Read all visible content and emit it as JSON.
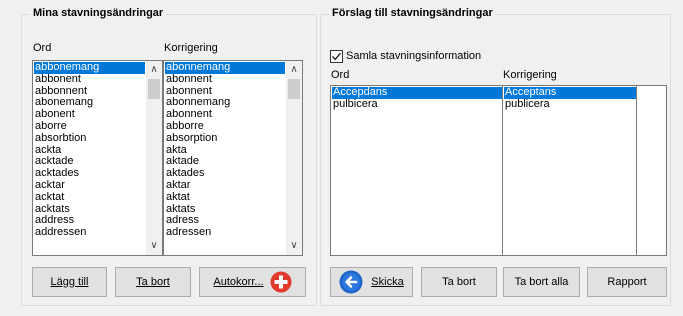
{
  "left_panel": {
    "title": "Mina stavningsändringar",
    "col_ord": "Ord",
    "col_korrigering": "Korrigering",
    "ord_items": [
      "abbonemang",
      "abbonent",
      "abbonnent",
      "abonemang",
      "abonent",
      "aborre",
      "absorbtion",
      "ackta",
      "acktade",
      "acktades",
      "acktar",
      "acktat",
      "acktats",
      "address",
      "addressen"
    ],
    "korr_items": [
      "abonnemang",
      "abonnent",
      "abonnent",
      "abonnemang",
      "abonnent",
      "abborre",
      "absorption",
      "akta",
      "aktade",
      "aktades",
      "aktar",
      "aktat",
      "aktats",
      "adress",
      "adressen"
    ],
    "buttons": {
      "add": "Lägg till",
      "remove": "Ta bort",
      "autocorrect": "Autokorr..."
    }
  },
  "right_panel": {
    "title": "Förslag till stavningsändringar",
    "collect_label": "Samla stavningsinformation",
    "collect_checked": true,
    "col_ord": "Ord",
    "col_korrigering": "Korrigering",
    "ord_items": [
      "Accepdans",
      "pulbicera"
    ],
    "korr_items": [
      "Acceptans",
      "publicera"
    ],
    "buttons": {
      "send": "Skicka",
      "remove": "Ta bort",
      "remove_all": "Ta bort alla",
      "report": "Rapport"
    }
  },
  "colors": {
    "selection": "#0078d7",
    "accent_blue": "#1e63c8",
    "accent_red": "#e03a2f"
  }
}
